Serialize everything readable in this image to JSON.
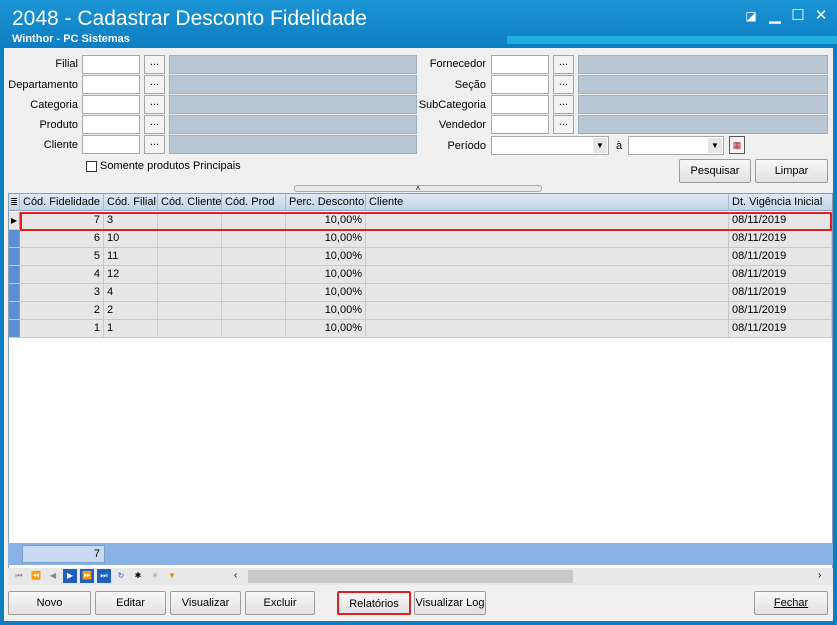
{
  "window": {
    "title": "2048 - Cadastrar Desconto Fidelidade",
    "subtitle": "Winthor - PC Sistemas"
  },
  "filters": {
    "filial_label": "Filial",
    "departamento_label": "Departamento",
    "categoria_label": "Categoria",
    "produto_label": "Produto",
    "cliente_label": "Cliente",
    "fornecedor_label": "Fornecedor",
    "secao_label": "Seção",
    "subcategoria_label": "SubCategoria",
    "vendedor_label": "Vendedor",
    "periodo_label": "Período",
    "periodo_sep": "à",
    "dots_label": "...",
    "somente_principais_label": "Somente produtos Principais"
  },
  "buttons": {
    "pesquisar": "Pesquisar",
    "limpar": "Limpar",
    "novo": "Novo",
    "editar": "Editar",
    "visualizar": "Visualizar",
    "excluir": "Excluir",
    "relatorios": "Relatórios",
    "visualizar_log": "Visualizar Log",
    "fechar": "Fechar"
  },
  "grid": {
    "columns": [
      "Cód. Fidelidade",
      "Cód. Filial",
      "Cód. Cliente",
      "Cód. Prod",
      "Perc. Desconto",
      "Cliente",
      "Dt. Vigência Inicial"
    ],
    "rows": [
      {
        "cod_fidelidade": "7",
        "cod_filial": "3",
        "cod_cliente": "",
        "cod_prod": "",
        "perc_desconto": "10,00%",
        "cliente": "",
        "dt_vigencia": "08/11/2019"
      },
      {
        "cod_fidelidade": "6",
        "cod_filial": "10",
        "cod_cliente": "",
        "cod_prod": "",
        "perc_desconto": "10,00%",
        "cliente": "",
        "dt_vigencia": "08/11/2019"
      },
      {
        "cod_fidelidade": "5",
        "cod_filial": "11",
        "cod_cliente": "",
        "cod_prod": "",
        "perc_desconto": "10,00%",
        "cliente": "",
        "dt_vigencia": "08/11/2019"
      },
      {
        "cod_fidelidade": "4",
        "cod_filial": "12",
        "cod_cliente": "",
        "cod_prod": "",
        "perc_desconto": "10,00%",
        "cliente": "",
        "dt_vigencia": "08/11/2019"
      },
      {
        "cod_fidelidade": "3",
        "cod_filial": "4",
        "cod_cliente": "",
        "cod_prod": "",
        "perc_desconto": "10,00%",
        "cliente": "",
        "dt_vigencia": "08/11/2019"
      },
      {
        "cod_fidelidade": "2",
        "cod_filial": "2",
        "cod_cliente": "",
        "cod_prod": "",
        "perc_desconto": "10,00%",
        "cliente": "",
        "dt_vigencia": "08/11/2019"
      },
      {
        "cod_fidelidade": "1",
        "cod_filial": "1",
        "cod_cliente": "",
        "cod_prod": "",
        "perc_desconto": "10,00%",
        "cliente": "",
        "dt_vigencia": "08/11/2019"
      }
    ],
    "footer_count": "7"
  },
  "colors": {
    "title_bar": "#0d7ec2",
    "selection_outline": "#e02020",
    "row_indicator": "#5b8ed3"
  }
}
